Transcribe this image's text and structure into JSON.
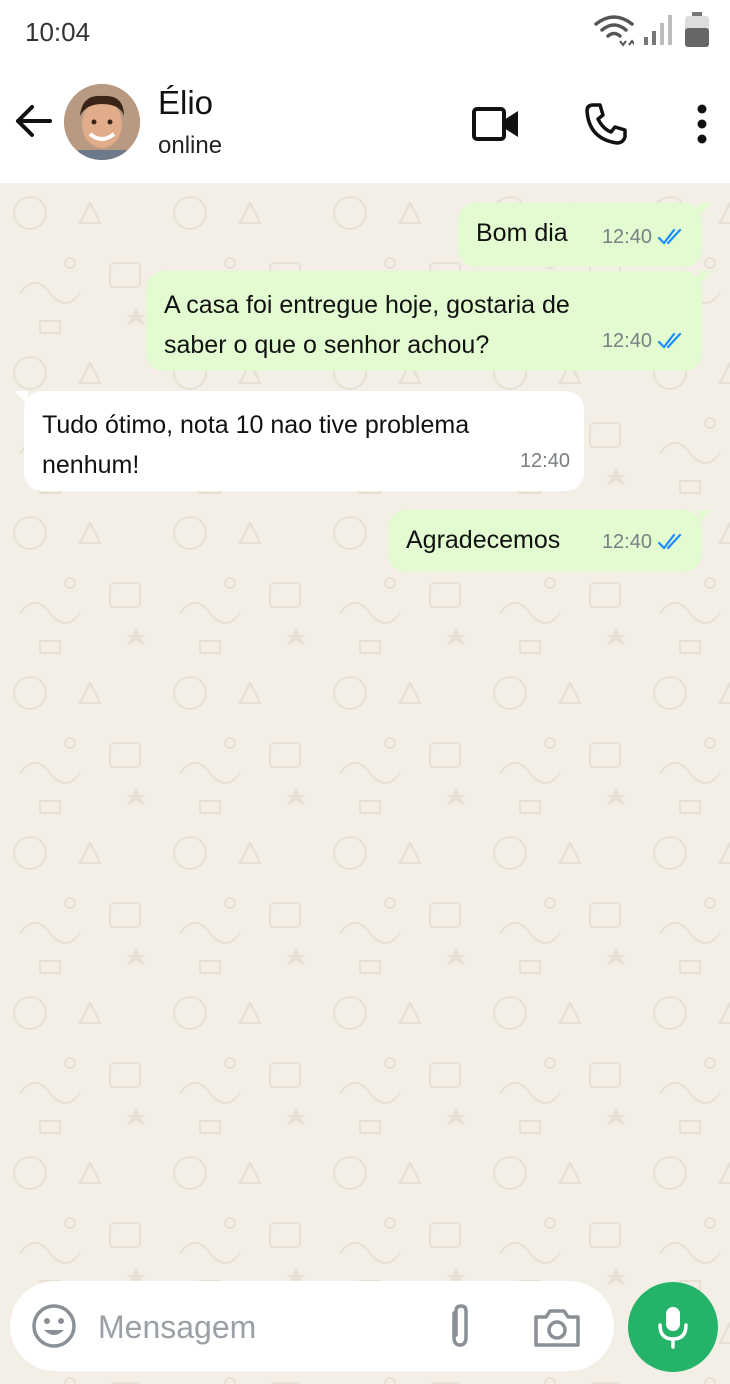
{
  "status_bar": {
    "time": "10:04"
  },
  "contact": {
    "name": "Élio",
    "status": "online"
  },
  "messages": [
    {
      "direction": "out",
      "lines": [
        "Bom dia"
      ],
      "time": "12:40",
      "read": true
    },
    {
      "direction": "out",
      "lines": [
        "A casa foi entregue hoje, gostaria de",
        "saber o que o senhor achou?"
      ],
      "time": "12:40",
      "read": true
    },
    {
      "direction": "in",
      "lines": [
        "Tudo ótimo, nota 10 nao tive problema",
        "nenhum!"
      ],
      "time": "12:40"
    },
    {
      "direction": "out",
      "lines": [
        "Agradecemos"
      ],
      "time": "12:40",
      "read": true
    }
  ],
  "composer": {
    "placeholder": "Mensagem"
  },
  "icons": {
    "back": "arrow-left-icon",
    "video": "video-camera-icon",
    "call": "phone-icon",
    "menu": "more-vertical-icon",
    "emoji": "emoji-icon",
    "attach": "paperclip-icon",
    "camera": "camera-icon",
    "mic": "microphone-icon",
    "read_receipt": "double-check-icon",
    "wifi": "wifi-icon",
    "signal": "signal-icon",
    "battery": "battery-icon"
  },
  "colors": {
    "outgoing_bubble": "#e2fbd0",
    "incoming_bubble": "#ffffff",
    "chat_background": "#f3efe7",
    "accent": "#25b36a",
    "read_tick": "#1a8cff"
  }
}
